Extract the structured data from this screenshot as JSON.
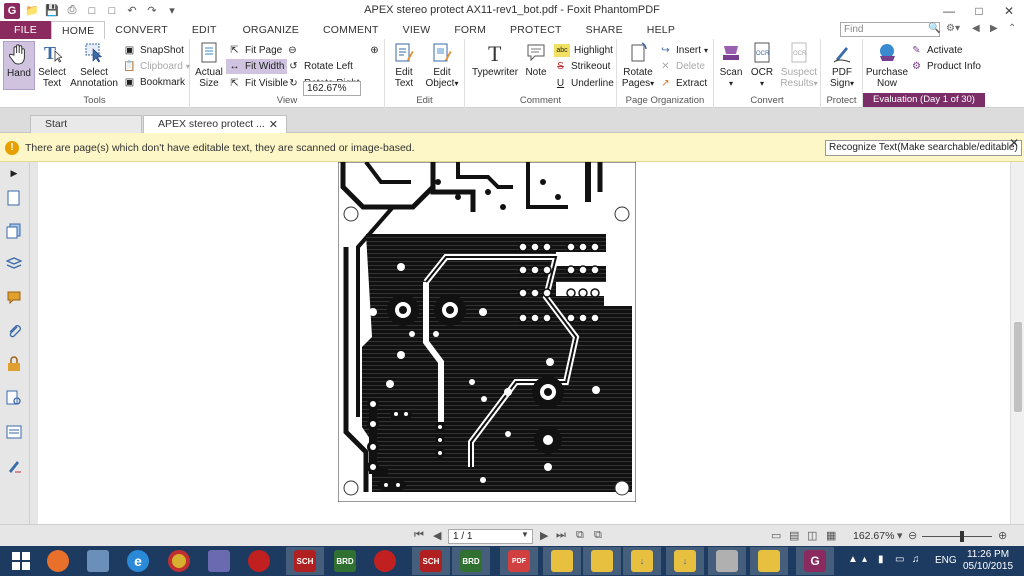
{
  "window": {
    "title": "APEX stereo protect AX11-rev1_bot.pdf - Foxit PhantomPDF",
    "logo": "G"
  },
  "ribbon_tabs": [
    "FILE",
    "HOME",
    "CONVERT",
    "EDIT",
    "ORGANIZE",
    "COMMENT",
    "VIEW",
    "FORM",
    "PROTECT",
    "SHARE",
    "HELP"
  ],
  "search": {
    "placeholder": "Find"
  },
  "tools_group": {
    "label": "Tools",
    "hand": "Hand",
    "select_text": "Select Text",
    "select_annotation": "Select Annotation",
    "snapshot": "SnapShot",
    "clipboard": "Clipboard",
    "bookmark": "Bookmark"
  },
  "view_group": {
    "label": "View",
    "actual_size": "Actual Size",
    "fit_page": "Fit Page",
    "fit_width": "Fit Width",
    "fit_visible": "Fit Visible",
    "zoom": "162.67%",
    "rotate_left": "Rotate Left",
    "rotate_right": "Rotate Right"
  },
  "edit_group": {
    "label": "Edit",
    "edit_text": "Edit Text",
    "edit_object": "Edit Object"
  },
  "comment_group": {
    "label": "Comment",
    "typewriter": "Typewriter",
    "note": "Note",
    "highlight": "Highlight",
    "strikeout": "Strikeout",
    "underline": "Underline"
  },
  "pageorg_group": {
    "label": "Page Organization",
    "rotate_pages": "Rotate Pages",
    "insert": "Insert",
    "delete": "Delete",
    "extract": "Extract"
  },
  "convert_group": {
    "label": "Convert",
    "scan": "Scan",
    "ocr": "OCR",
    "suspect_results": "Suspect Results"
  },
  "protect_group": {
    "label": "Protect",
    "pdf_sign": "PDF Sign"
  },
  "eval_group": {
    "purchase_now": "Purchase Now",
    "activate": "Activate",
    "product_info": "Product Info",
    "badge": "Evaluation (Day 1 of 30)"
  },
  "doc_tabs": [
    "Start",
    "APEX stereo protect ..."
  ],
  "notification": {
    "message": "There are page(s) which don't have editable text, they are scanned or image-based.",
    "action": "Recognize Text(Make searchable/editable)"
  },
  "statusbar": {
    "page": "1 / 1",
    "zoom": "162.67%"
  },
  "taskbar": {
    "items": [
      "windows-start",
      "firefox",
      "calculator",
      "ie",
      "chrome",
      "paint",
      "app-red-1",
      "sch-1",
      "brd-1",
      "app-red-2",
      "sch-2",
      "brd-2",
      "pdf-viewer",
      "folder-1",
      "folder-2",
      "folder-3",
      "folder-4",
      "drive",
      "folder-5",
      "foxit"
    ],
    "sch_label": "SCH",
    "brd_label": "BRD",
    "pdf_label": "PDF",
    "lang": "ENG",
    "time": "11:26 PM",
    "date": "05/10/2015"
  },
  "colors": {
    "brand": "#8a2a5f",
    "eval_badge": "#7a2d66",
    "notif_bg": "#fdf6c6",
    "taskbar": "#1d3b60"
  }
}
